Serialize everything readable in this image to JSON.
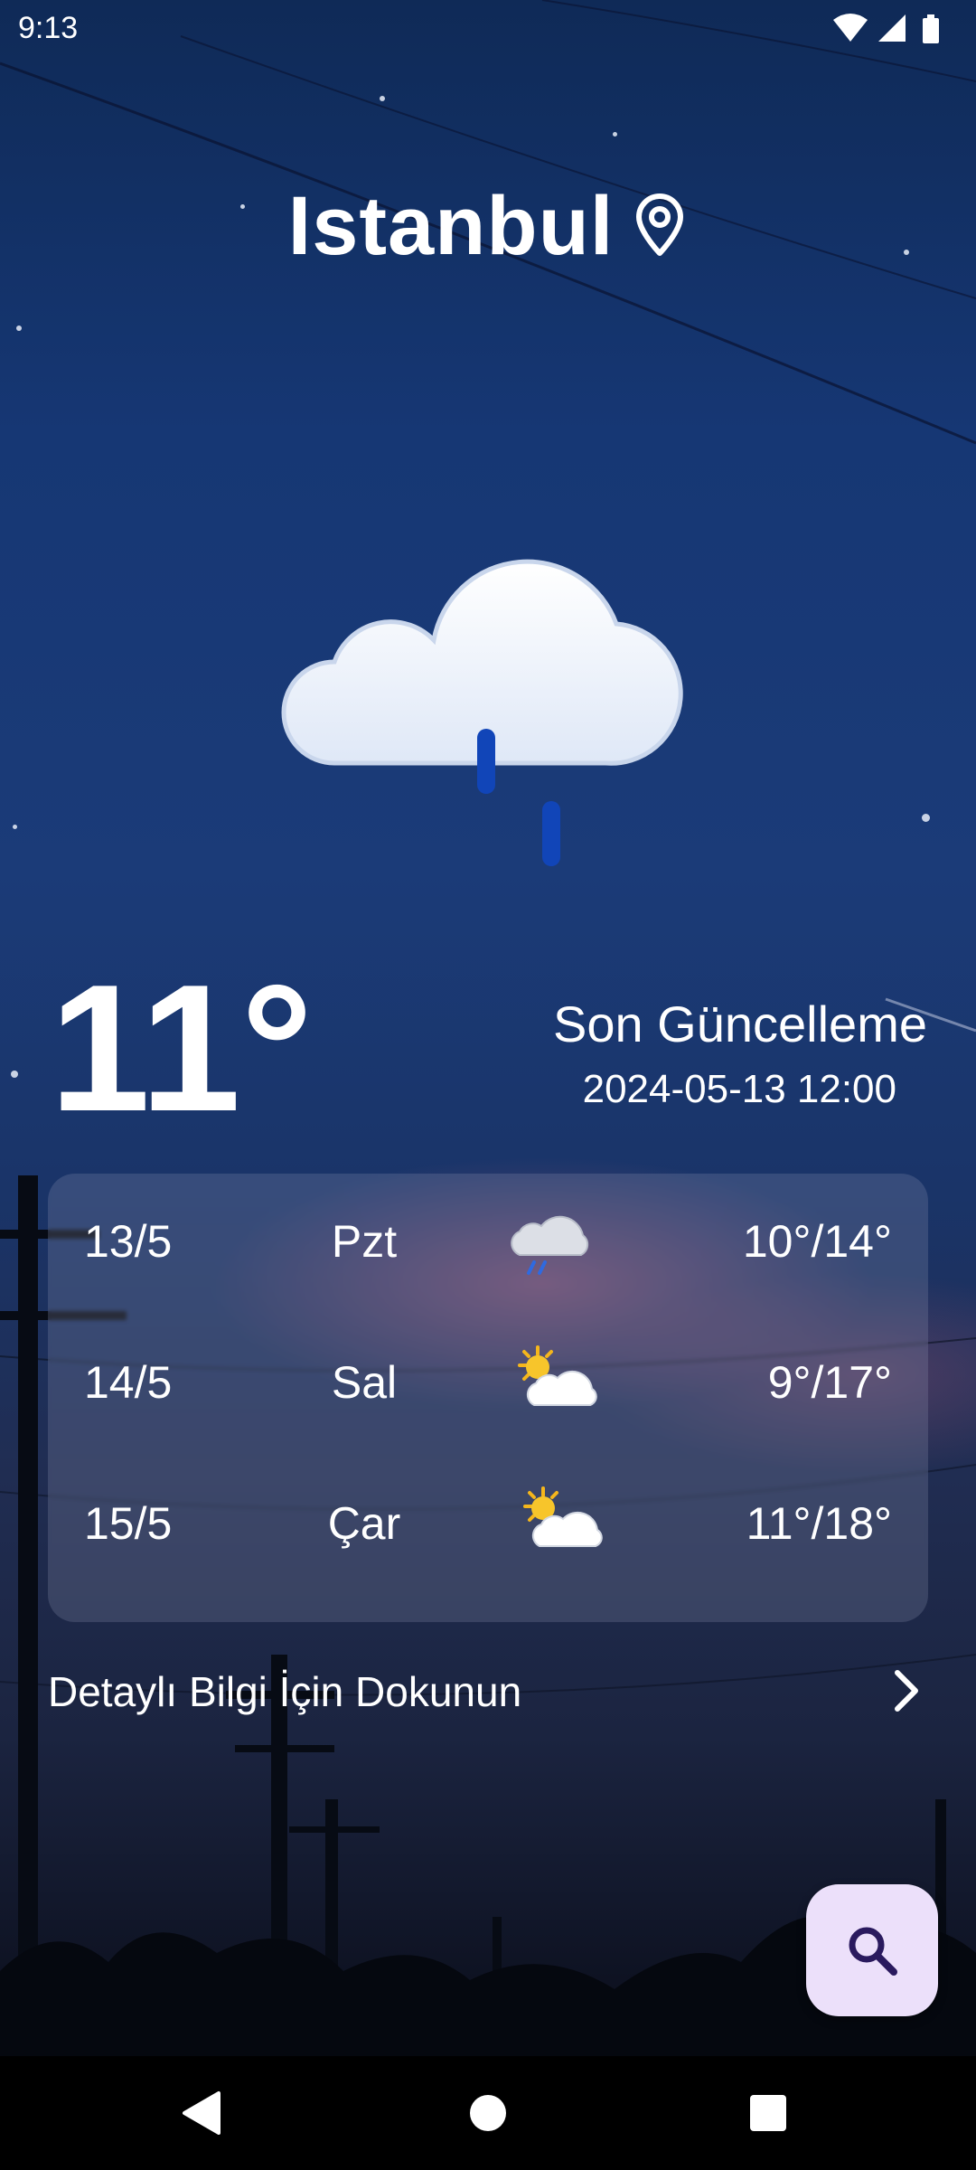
{
  "status_bar": {
    "time": "9:13"
  },
  "location": {
    "city": "Istanbul",
    "icon": "location-pin-icon"
  },
  "current": {
    "icon": "cloud-rain-icon",
    "temperature": "11°",
    "last_update_label": "Son Güncelleme",
    "last_update_time": "2024-05-13 12:00"
  },
  "forecast": [
    {
      "date": "13/5",
      "day": "Pzt",
      "icon": "rain-cloud-icon",
      "temps": "10°/14°"
    },
    {
      "date": "14/5",
      "day": "Sal",
      "icon": "partly-sunny-icon",
      "temps": "9°/17°"
    },
    {
      "date": "15/5",
      "day": "Çar",
      "icon": "partly-sunny-icon",
      "temps": "11°/18°"
    }
  ],
  "details": {
    "label": "Detaylı Bilgi İçin Dokunun",
    "icon": "chevron-right-icon"
  },
  "fab": {
    "icon": "search-icon"
  },
  "colors": {
    "fab_bg": "#ece0fa",
    "fab_icon": "#2a1a5e",
    "rain_drop": "#1145b8"
  }
}
